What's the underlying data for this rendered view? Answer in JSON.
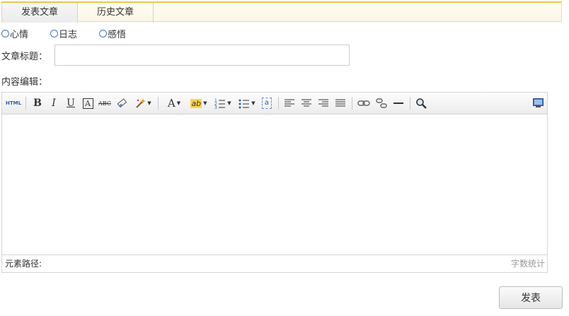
{
  "tabs": [
    {
      "label": "发表文章",
      "active": true
    },
    {
      "label": "历史文章",
      "active": false
    }
  ],
  "radios": [
    {
      "label": "心情"
    },
    {
      "label": "日志"
    },
    {
      "label": "感悟"
    }
  ],
  "form": {
    "title_label": "文章标题：",
    "title_value": "",
    "content_label": "内容编辑："
  },
  "editor": {
    "toolbar": {
      "html_label": "HTML",
      "bold_label": "B",
      "italic_label": "I",
      "underline_label": "U",
      "strikethrough_label": "ABC",
      "font_color_label": "A",
      "highlight_label": "ab",
      "tools": [
        "source-html",
        "bold",
        "italic",
        "underline",
        "font-border",
        "strikethrough",
        "eraser",
        "format-painter",
        "font-color",
        "highlight-color",
        "ordered-list",
        "unordered-list",
        "plain-text",
        "align-left",
        "align-center",
        "align-right",
        "justify",
        "link",
        "unlink",
        "horizontal-rule",
        "search-replace",
        "fullscreen"
      ]
    },
    "content": "",
    "status_path_label": "元素路径:",
    "word_count_label": "字数统计"
  },
  "submit_label": "发表",
  "colors": {
    "tab_accent": "#e8c84a",
    "radio_border": "#4a78c2"
  }
}
